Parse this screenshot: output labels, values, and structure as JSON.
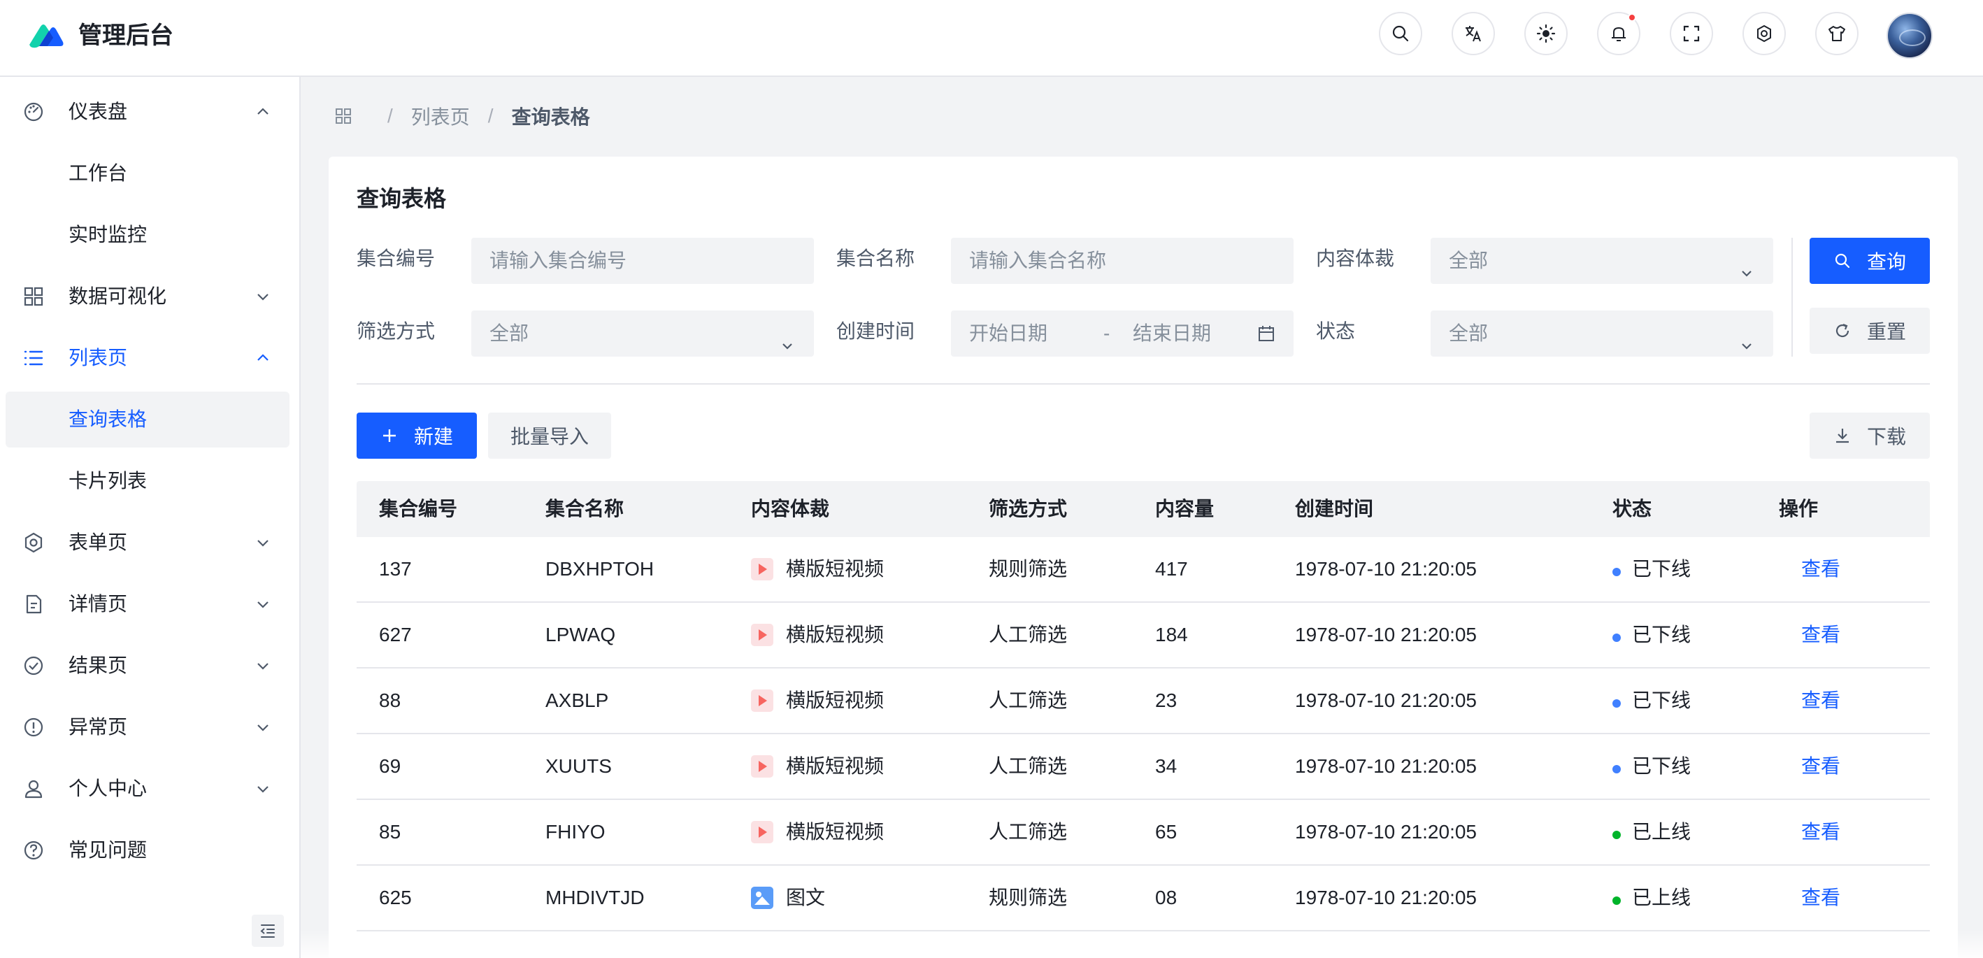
{
  "app": {
    "title": "管理后台",
    "logo_icon": "logo-icon",
    "brand_colors": [
      "#165dff",
      "#12d2ac"
    ]
  },
  "header": {
    "buttons": [
      {
        "name": "search-icon"
      },
      {
        "name": "translate-icon"
      },
      {
        "name": "theme-sun-icon"
      },
      {
        "name": "notification-bell-icon",
        "has_badge": true
      },
      {
        "name": "fullscreen-icon"
      },
      {
        "name": "settings-gear-icon"
      },
      {
        "name": "skin-tshirt-icon"
      }
    ],
    "avatar": "user-avatar"
  },
  "sidebar": {
    "items": [
      {
        "label": "仪表盘",
        "icon": "dashboard-icon",
        "expanded": true
      },
      {
        "label": "工作台",
        "sub": true
      },
      {
        "label": "实时监控",
        "sub": true
      },
      {
        "label": "数据可视化",
        "icon": "grid-icon",
        "expanded": false
      },
      {
        "label": "列表页",
        "icon": "list-icon",
        "expanded": true,
        "active": true
      },
      {
        "label": "查询表格",
        "sub": true,
        "selected": true
      },
      {
        "label": "卡片列表",
        "sub": true
      },
      {
        "label": "表单页",
        "icon": "settings-icon",
        "expanded": false
      },
      {
        "label": "详情页",
        "icon": "file-icon",
        "expanded": false
      },
      {
        "label": "结果页",
        "icon": "check-circle-icon",
        "expanded": false
      },
      {
        "label": "异常页",
        "icon": "exclamation-circle-icon",
        "expanded": false
      },
      {
        "label": "个人中心",
        "icon": "user-icon",
        "expanded": false
      },
      {
        "label": "常见问题",
        "icon": "question-circle-icon"
      }
    ],
    "active_color": "#165dff"
  },
  "breadcrumb": {
    "items": [
      "列表页",
      "查询表格"
    ]
  },
  "page": {
    "title": "查询表格"
  },
  "filters": {
    "collection_id": {
      "label": "集合编号",
      "placeholder": "请输入集合编号"
    },
    "collection_name": {
      "label": "集合名称",
      "placeholder": "请输入集合名称"
    },
    "content_type": {
      "label": "内容体裁",
      "value": "全部"
    },
    "filter_type": {
      "label": "筛选方式",
      "value": "全部"
    },
    "created_time": {
      "label": "创建时间",
      "start": "开始日期",
      "separator": "-",
      "end": "结束日期"
    },
    "status": {
      "label": "状态",
      "value": "全部"
    },
    "query_label": "查询",
    "reset_label": "重置"
  },
  "toolbar": {
    "new_label": "新建",
    "import_label": "批量导入",
    "download_label": "下载"
  },
  "table": {
    "columns": [
      "集合编号",
      "集合名称",
      "内容体裁",
      "筛选方式",
      "内容量",
      "创建时间",
      "状态",
      "操作"
    ],
    "rows": [
      {
        "id": "137",
        "name": "DBXHPTOH",
        "type": "横版短视频",
        "type_icon": "video",
        "filter": "规则筛选",
        "count": "417",
        "time": "1978-07-10 21:20:05",
        "status": "已下线",
        "status_color": "#4080ff",
        "action": "查看"
      },
      {
        "id": "627",
        "name": "LPWAQ",
        "type": "横版短视频",
        "type_icon": "video",
        "filter": "人工筛选",
        "count": "184",
        "time": "1978-07-10 21:20:05",
        "status": "已下线",
        "status_color": "#4080ff",
        "action": "查看"
      },
      {
        "id": "88",
        "name": "AXBLP",
        "type": "横版短视频",
        "type_icon": "video",
        "filter": "人工筛选",
        "count": "23",
        "time": "1978-07-10 21:20:05",
        "status": "已下线",
        "status_color": "#4080ff",
        "action": "查看"
      },
      {
        "id": "69",
        "name": "XUUTS",
        "type": "横版短视频",
        "type_icon": "video",
        "filter": "人工筛选",
        "count": "34",
        "time": "1978-07-10 21:20:05",
        "status": "已下线",
        "status_color": "#4080ff",
        "action": "查看"
      },
      {
        "id": "85",
        "name": "FHIYO",
        "type": "横版短视频",
        "type_icon": "video",
        "filter": "人工筛选",
        "count": "65",
        "time": "1978-07-10 21:20:05",
        "status": "已上线",
        "status_color": "#00b42a",
        "action": "查看"
      },
      {
        "id": "625",
        "name": "MHDIVTJD",
        "type": "图文",
        "type_icon": "image",
        "filter": "规则筛选",
        "count": "08",
        "time": "1978-07-10 21:20:05",
        "status": "已上线",
        "status_color": "#00b42a",
        "action": "查看"
      }
    ]
  }
}
